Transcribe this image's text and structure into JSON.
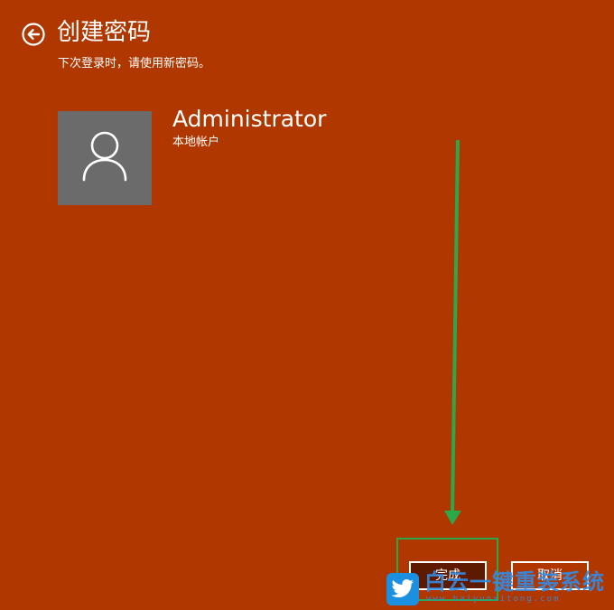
{
  "header": {
    "back_icon": "back-arrow-circle-icon",
    "title": "创建密码",
    "subtitle": "下次登录时，请使用新密码。"
  },
  "account": {
    "avatar_icon": "user-silhouette-icon",
    "name": "Administrator",
    "type": "本地帐户"
  },
  "buttons": {
    "finish_label": "完成",
    "cancel_label": "取消"
  },
  "annotation": {
    "arrow_color": "#2aa84a",
    "box_color": "#2aa84a"
  },
  "watermark": {
    "title": "白云一键重装系统",
    "url": "www.baiyunxitong.com",
    "logo_icon": "twitter-bird-icon"
  },
  "colors": {
    "background": "#b03700",
    "avatar_bg": "#6b6b6b",
    "finish_button_bg": "#5e1a00"
  }
}
